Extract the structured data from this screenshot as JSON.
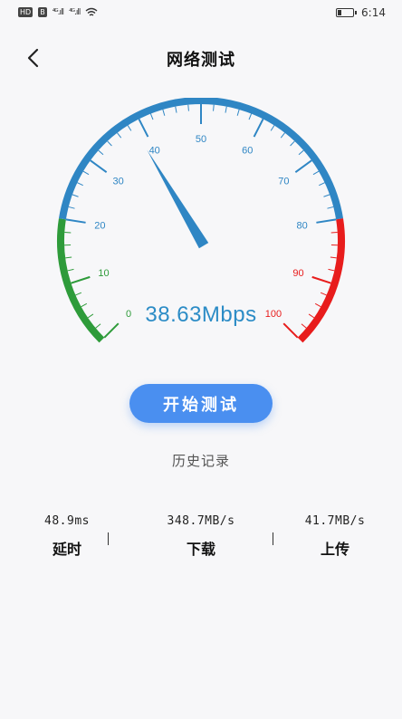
{
  "status_bar": {
    "left_chips": [
      "HD",
      "B"
    ],
    "signals": [
      "⁴ᴳ.ıll",
      "⁴ᴳ.ıll"
    ],
    "time": "6:14",
    "battery_level": 0.25
  },
  "header": {
    "title": "网络测试",
    "back_icon": "chevron-left-icon"
  },
  "gauge": {
    "min": 0,
    "max": 100,
    "current_value": 38.63,
    "readout": "38.63Mbps",
    "tick_labels": [
      "0",
      "10",
      "20",
      "30",
      "40",
      "50",
      "60",
      "70",
      "80",
      "90",
      "100"
    ],
    "colors": {
      "low": "#2e9b3a",
      "mid": "#2f86c4",
      "high": "#e81c1c",
      "needle": "#2f86c4"
    }
  },
  "actions": {
    "start_label": "开始测试",
    "history_label": "历史记录"
  },
  "stats": [
    {
      "value": "48.9ms",
      "label": "延时"
    },
    {
      "value": "348.7MB/s",
      "label": "下载"
    },
    {
      "value": "41.7MB/s",
      "label": "上传"
    }
  ]
}
